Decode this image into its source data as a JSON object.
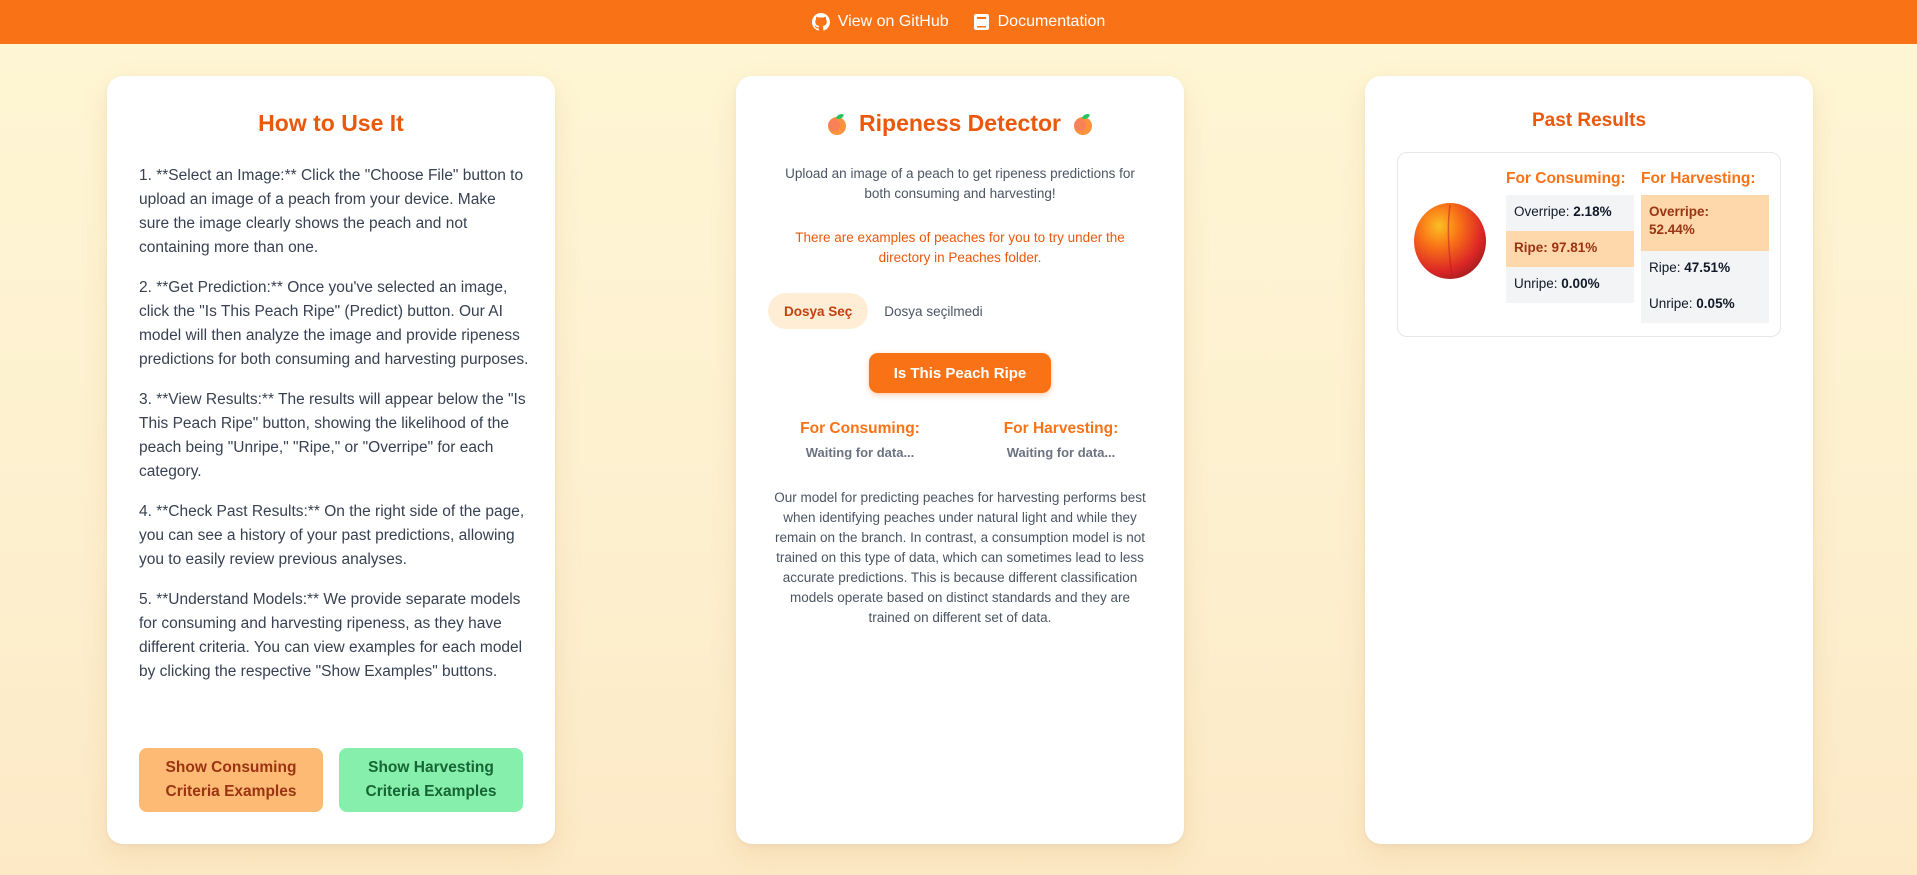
{
  "topbar": {
    "github_label": "View on GitHub",
    "docs_label": "Documentation"
  },
  "left": {
    "title": "How to Use It",
    "steps": [
      "1. **Select an Image:** Click the \"Choose File\" button to upload an image of a peach from your device. Make sure the image clearly shows the peach and not containing more than one.",
      "2. **Get Prediction:** Once you've selected an image, click the \"Is This Peach Ripe\" (Predict) button. Our AI model will then analyze the image and provide ripeness predictions for both consuming and harvesting purposes.",
      "3. **View Results:** The results will appear below the \"Is This Peach Ripe\" button, showing the likelihood of the peach being \"Unripe,\" \"Ripe,\" or \"Overripe\" for each category.",
      "4. **Check Past Results:** On the right side of the page, you can see a history of your past predictions, allowing you to easily review previous analyses.",
      "5. **Understand Models:** We provide separate models for consuming and harvesting ripeness, as they have different criteria. You can view examples for each model by clicking the respective \"Show Examples\" buttons."
    ],
    "btn_consuming": "Show Consuming Criteria Examples",
    "btn_harvesting": "Show Harvesting Criteria Examples"
  },
  "middle": {
    "title": "Ripeness Detector",
    "description": "Upload an image of a peach to get ripeness predictions for both consuming and harvesting!",
    "note": "There are examples of peaches for you to try under the directory in Peaches folder.",
    "file_button": "Dosya Seç",
    "file_status": "Dosya seçilmedi",
    "predict_button": "Is This Peach Ripe",
    "consuming_label": "For Consuming:",
    "harvesting_label": "For Harvesting:",
    "waiting": "Waiting for data...",
    "info": "Our model for predicting peaches for harvesting performs best when identifying peaches under natural light and while they remain on the branch. In contrast, a consumption model is not trained on this type of data, which can sometimes lead to less accurate predictions. This is because different classification models operate based on distinct standards and they are trained on different set of data."
  },
  "right": {
    "title": "Past Results",
    "result": {
      "consuming": {
        "label": "For Consuming:",
        "overripe_label": "Overripe:",
        "overripe": "2.18%",
        "ripe_label": "Ripe:",
        "ripe": "97.81%",
        "unripe_label": "Unripe:",
        "unripe": "0.00%"
      },
      "harvesting": {
        "label": "For Harvesting:",
        "overripe_label": "Overripe:",
        "overripe": "52.44%",
        "ripe_label": "Ripe:",
        "ripe": "47.51%",
        "unripe_label": "Unripe:",
        "unripe": "0.05%"
      }
    }
  },
  "colors": {
    "accent": "#f97316",
    "title": "#ea580c",
    "consume_btn": "#fdba74",
    "harvest_btn": "#86efac",
    "highlight": "#fed7aa"
  },
  "icons": [
    "github-icon",
    "book-icon",
    "peach-emoji-icon",
    "peach-photo"
  ]
}
